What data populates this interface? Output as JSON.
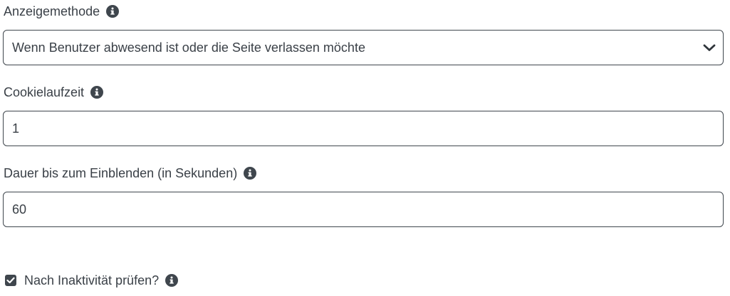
{
  "display_method": {
    "label": "Anzeigemethode",
    "selected": "Wenn Benutzer abwesend ist oder die Seite verlassen möchte"
  },
  "cookie_duration": {
    "label": "Cookielaufzeit",
    "value": "1"
  },
  "delay": {
    "label": "Dauer bis zum Einblenden (in Sekunden)",
    "value": "60"
  },
  "inactivity_check": {
    "label": "Nach Inaktivität prüfen?",
    "checked": true
  },
  "colors": {
    "text": "#3a4047",
    "border": "#3f464d",
    "icon": "#3f464d"
  },
  "icons": [
    "info-icon",
    "chevron-down-icon",
    "checkmark-icon"
  ]
}
